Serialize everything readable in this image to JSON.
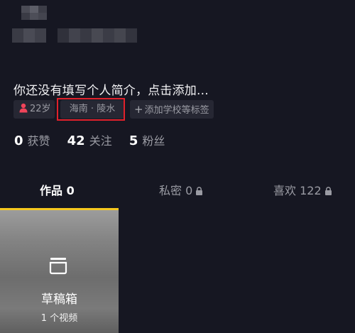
{
  "profile": {
    "bio_placeholder": "你还没有填写个人简介，点击添加...",
    "tags": {
      "age": "22岁",
      "location": "海南 · 陵水",
      "add_tag": "添加学校等标签"
    },
    "stats": [
      {
        "value": "0",
        "label": "获赞"
      },
      {
        "value": "42",
        "label": "关注"
      },
      {
        "value": "5",
        "label": "粉丝"
      }
    ]
  },
  "tabs": [
    {
      "label": "作品 0",
      "active": true
    },
    {
      "label": "私密 0",
      "locked": true
    },
    {
      "label": "喜欢 122",
      "locked": true
    }
  ],
  "draft": {
    "title": "草稿箱",
    "count": "1 个视频"
  },
  "colors": {
    "background": "#161722",
    "active_tab_indicator": "#f6c81f",
    "highlight_box": "#e1212b",
    "age_icon": "#f0445a"
  },
  "icons": {
    "age": "person-icon",
    "add": "plus-icon",
    "lock": "lock-icon",
    "draft": "draft-box-icon"
  }
}
